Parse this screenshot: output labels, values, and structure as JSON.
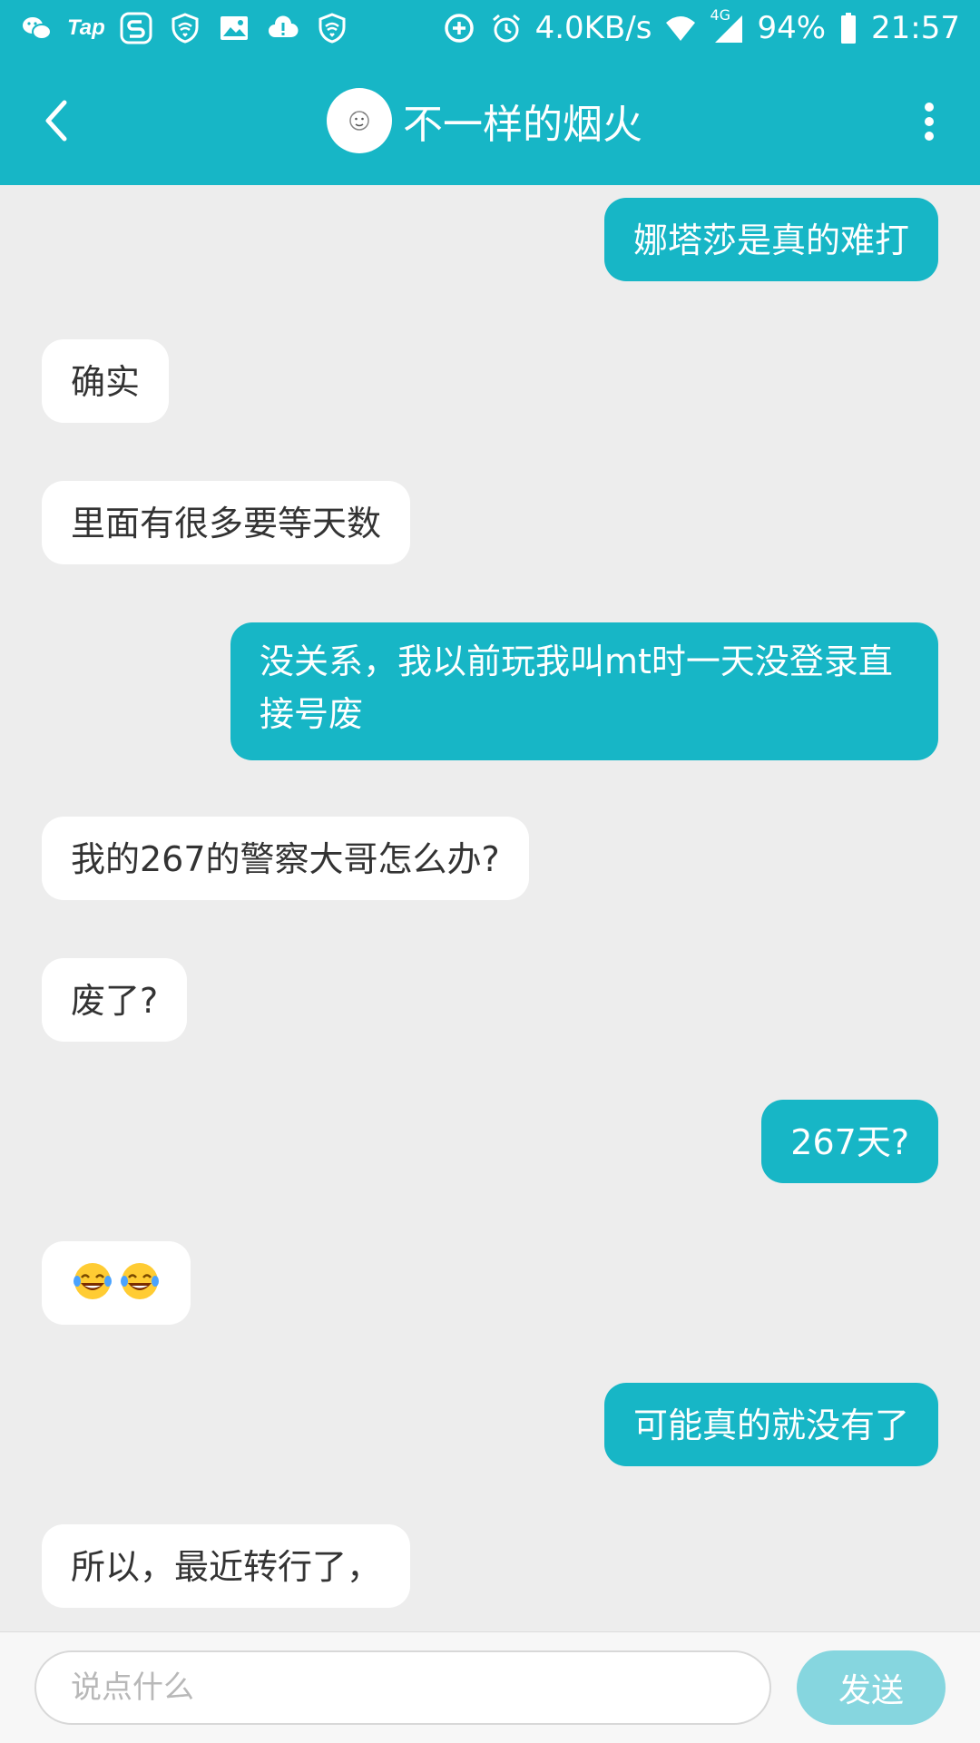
{
  "status_bar": {
    "tap_label": "Tap",
    "network_speed": "4.0KB/s",
    "network_type": "4G",
    "battery": "94%",
    "time": "21:57",
    "left_icons": [
      "wechat-icon",
      "tap-icon",
      "s-icon",
      "vpn-shield-icon",
      "image-icon",
      "cloud-icon",
      "vpn-shield-icon"
    ],
    "right_icons": [
      "data-saver-icon",
      "alarm-icon",
      "wifi-icon",
      "signal-icon",
      "battery-icon"
    ]
  },
  "header": {
    "title": "不一样的烟火",
    "back_icon": "chevron-left-icon",
    "more_icon": "more-vertical-icon"
  },
  "colors": {
    "brand": "#17b6c6",
    "background": "#ededed",
    "send_disabled": "#86d6df"
  },
  "messages": [
    {
      "side": "right",
      "text": "娜塔莎是真的难打"
    },
    {
      "side": "left",
      "text": "确实"
    },
    {
      "side": "left",
      "text": "里面有很多要等天数"
    },
    {
      "side": "right",
      "text": "没关系，我以前玩我叫mt时一天没登录直接号废"
    },
    {
      "side": "left",
      "text": "我的267的警察大哥怎么办?"
    },
    {
      "side": "left",
      "text": "废了?"
    },
    {
      "side": "right",
      "text": "267天?"
    },
    {
      "side": "left",
      "text": "😂😂"
    },
    {
      "side": "right",
      "text": "可能真的就没有了"
    },
    {
      "side": "left",
      "text": "所以，最近转行了，"
    }
  ],
  "input": {
    "value": "",
    "placeholder": "说点什么",
    "send_label": "发送"
  }
}
